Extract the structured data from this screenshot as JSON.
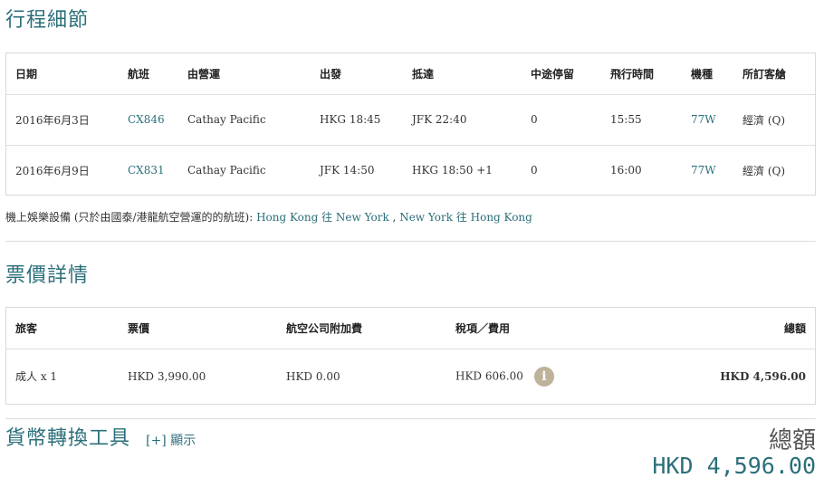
{
  "itinerary": {
    "title": "行程細節",
    "headers": [
      "日期",
      "航班",
      "由營運",
      "出發",
      "抵達",
      "中途停留",
      "飛行時間",
      "機種",
      "所訂客艙"
    ],
    "rows": [
      {
        "date": "2016年6月3日",
        "flight": "CX846",
        "operator": "Cathay Pacific",
        "departure": "HKG 18:45",
        "arrival": "JFK 22:40",
        "stops": "0",
        "duration": "15:55",
        "aircraft": "77W",
        "cabin": "經濟 (Q)"
      },
      {
        "date": "2016年6月9日",
        "flight": "CX831",
        "operator": "Cathay Pacific",
        "departure": "JFK 14:50",
        "arrival": "HKG 18:50 +1",
        "stops": "0",
        "duration": "16:00",
        "aircraft": "77W",
        "cabin": "經濟 (Q)"
      }
    ]
  },
  "ife": {
    "label": "機上娛樂設備 (只於由國泰/港龍航空營運的的航班):",
    "link1": "Hong Kong 往 New York",
    "separator": ",",
    "link2": "New York 往 Hong Kong"
  },
  "fare": {
    "title": "票價詳情",
    "headers": {
      "passenger": "旅客",
      "fare": "票價",
      "surcharge": "航空公司附加費",
      "taxes": "稅項／費用",
      "total": "總額"
    },
    "row": {
      "passenger": "成人 x 1",
      "fare": "HKD 3,990.00",
      "surcharge": "HKD 0.00",
      "taxes": "HKD 606.00",
      "info_icon": "i",
      "total": "HKD 4,596.00"
    }
  },
  "currency_tool": {
    "title": "貨幣轉換工具",
    "toggle_label": "[+] 顯示"
  },
  "grand_total": {
    "label": "總額",
    "value": "HKD 4,596.00"
  },
  "colors": {
    "accent": "#2b6f7a",
    "info_icon": "#bfb29a",
    "border": "#d9d9d9"
  }
}
